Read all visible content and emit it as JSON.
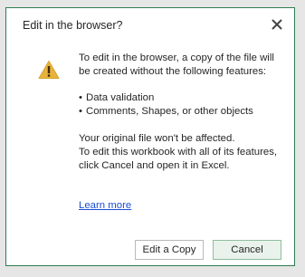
{
  "dialog": {
    "title": "Edit in the browser?",
    "close_icon": "close-icon",
    "warning_icon": "warning-icon",
    "intro": "To edit in the browser, a copy of the file will be created without the following features:",
    "features": [
      "Data validation",
      "Comments, Shapes, or other objects"
    ],
    "note_line1": "Your original file won't be affected.",
    "note_line2": "To edit this workbook with all of its features, click Cancel and open it in Excel.",
    "learn_more": "Learn more",
    "buttons": {
      "edit_copy": "Edit a Copy",
      "cancel": "Cancel"
    }
  },
  "colors": {
    "border": "#2e7d4f",
    "warning": "#e8b33c",
    "link": "#1a4fd6",
    "cancel_bg": "#eaf2ec"
  }
}
